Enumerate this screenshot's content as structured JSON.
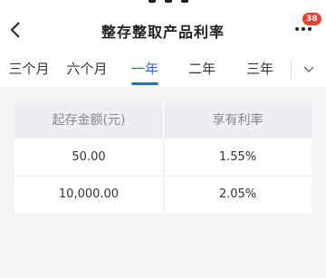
{
  "header": {
    "title": "整存整取产品利率",
    "badge_count": "38",
    "back_icon": "chevron-left-icon",
    "more_icon": "more-dots-icon"
  },
  "tabs": {
    "items": [
      {
        "label": "三个月",
        "active": false
      },
      {
        "label": "六个月",
        "active": false
      },
      {
        "label": "一年",
        "active": true
      },
      {
        "label": "二年",
        "active": false
      },
      {
        "label": "三年",
        "active": false
      }
    ],
    "expand_icon": "chevron-down-icon",
    "active_color": "#1f6fd9"
  },
  "rate_table": {
    "headers": [
      "起存金额(元)",
      "享有利率"
    ],
    "rows": [
      [
        "50.00",
        "1.55%"
      ],
      [
        "10,000.00",
        "2.05%"
      ]
    ]
  },
  "colors": {
    "badge": "#e9402f",
    "background": "#f3f4f6",
    "table_header": "#eceef2"
  }
}
